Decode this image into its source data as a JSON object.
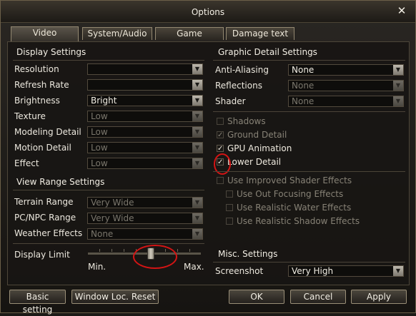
{
  "window": {
    "title": "Options"
  },
  "tabs": [
    "Video",
    "System/Audio",
    "Game",
    "Damage text"
  ],
  "display": {
    "section_title": "Display Settings",
    "rows": [
      {
        "label": "Resolution",
        "value": "",
        "enabled": true
      },
      {
        "label": "Refresh Rate",
        "value": "",
        "enabled": true
      },
      {
        "label": "Brightness",
        "value": "Bright",
        "enabled": true
      },
      {
        "label": "Texture",
        "value": "Low",
        "enabled": false
      },
      {
        "label": "Modeling Detail",
        "value": "Low",
        "enabled": false
      },
      {
        "label": "Motion Detail",
        "value": "Low",
        "enabled": false
      },
      {
        "label": "Effect",
        "value": "Low",
        "enabled": false
      }
    ]
  },
  "view_range": {
    "section_title": "View Range Settings",
    "rows": [
      {
        "label": "Terrain Range",
        "value": "Very Wide",
        "enabled": false
      },
      {
        "label": "PC/NPC Range",
        "value": "Very Wide",
        "enabled": false
      },
      {
        "label": "Weather Effects",
        "value": "None",
        "enabled": false
      }
    ],
    "display_limit": {
      "label": "Display Limit",
      "min_label": "Min.",
      "max_label": "Max.",
      "level": 0.56
    }
  },
  "graphic_detail": {
    "section_title": "Graphic Detail Settings",
    "rows": [
      {
        "label": "Anti-Aliasing",
        "value": "None",
        "enabled": true
      },
      {
        "label": "Reflections",
        "value": "None",
        "enabled": false
      },
      {
        "label": "Shader",
        "value": "None",
        "enabled": false
      }
    ],
    "checks": [
      {
        "label": "Shadows",
        "checked": false,
        "enabled": false
      },
      {
        "label": "Ground Detail",
        "checked": true,
        "enabled": false
      },
      {
        "label": "GPU Animation",
        "checked": true,
        "enabled": true
      },
      {
        "label": "Lower Detail",
        "checked": true,
        "enabled": true
      }
    ],
    "shader_checks": [
      {
        "label": "Use Improved Shader Effects",
        "checked": false,
        "enabled": false
      },
      {
        "label": "Use Out Focusing Effects",
        "checked": false,
        "enabled": false
      },
      {
        "label": "Use Realistic Water Effects",
        "checked": false,
        "enabled": false
      },
      {
        "label": "Use Realistic Shadow Effects",
        "checked": false,
        "enabled": false
      }
    ]
  },
  "misc": {
    "section_title": "Misc. Settings",
    "screenshot_label": "Screenshot",
    "screenshot_value": "Very High"
  },
  "buttons": {
    "basic": "Basic setting",
    "window_reset": "Window Loc. Reset",
    "ok": "OK",
    "cancel": "Cancel",
    "apply": "Apply"
  },
  "glyphs": {
    "close": "✕",
    "arrow": "▼",
    "check": "✓"
  },
  "colors": {
    "annotation_red": "#d41414"
  }
}
